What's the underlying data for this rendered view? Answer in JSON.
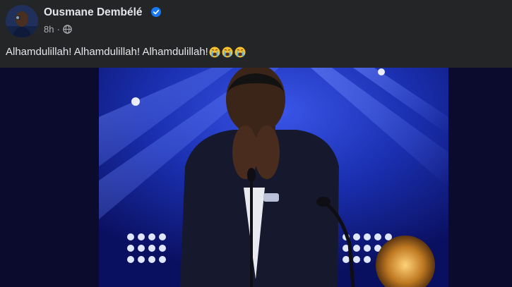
{
  "post": {
    "author_name": "Ousmane Dembélé",
    "timestamp": "8h",
    "separator": "·",
    "caption": "Alhamdulillah! Alhamdulillah! Alhamdulillah!",
    "caption_emojis": [
      "loudly-crying-face-emoji",
      "loudly-crying-face-emoji",
      "loudly-crying-face-emoji"
    ],
    "icons": {
      "verified": "verified-badge-icon",
      "audience": "globe-icon"
    },
    "colors": {
      "background": "#242526",
      "primary_text": "#e4e6eb",
      "secondary_text": "#b0b3b8",
      "verified_blue": "#1877f2",
      "stage_blue": "#1a2fb0"
    }
  }
}
